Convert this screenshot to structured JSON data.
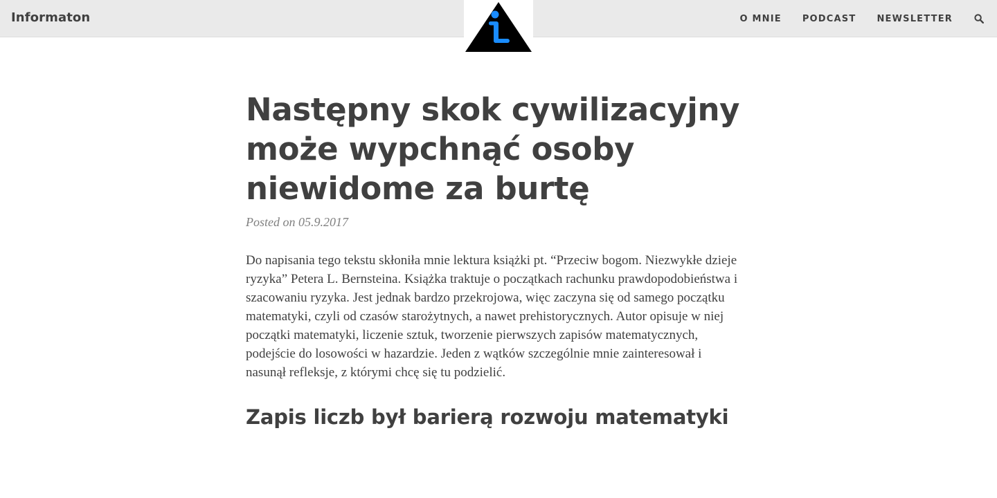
{
  "site": {
    "brand": "Informaton",
    "logo_icon": "info-triangle-logo",
    "logo_colors": {
      "triangle": "#000000",
      "glyph": "#1a8cff"
    }
  },
  "nav": {
    "items": [
      {
        "label": "O MNIE"
      },
      {
        "label": "PODCAST"
      },
      {
        "label": "NEWSLETTER"
      }
    ],
    "search_icon": "search-icon"
  },
  "post": {
    "title": "Następny skok cywilizacyjny może wypchnąć osoby niewidome za burtę",
    "meta": "Posted on 05.9.2017",
    "body": "Do napisania tego tekstu skłoniła mnie lektura książki pt. “Przeciw bogom. Niezwykłe dzieje ryzyka” Petera L. Bernsteina. Książka traktuje o początkach rachunku prawdopodobieństwa i szacowaniu ryzyka. Jest jednak bardzo przekrojowa, więc zaczyna się od samego początku matematyki, czyli od czasów starożytnych, a nawet prehistorycznych. Autor opisuje w niej początki matematyki, liczenie sztuk, tworzenie pierwszych zapisów matematycznych, podejście do losowości w hazardzie. Jeden z wątków szczególnie mnie zainteresował i nasunął refleksje, z którymi chcę się tu podzielić.",
    "section_heading": "Zapis liczb był barierą rozwoju matematyki"
  },
  "colors": {
    "navbar_bg": "#eaeaea",
    "text": "#404040",
    "meta": "#808080",
    "accent_blue": "#1a8cff"
  }
}
